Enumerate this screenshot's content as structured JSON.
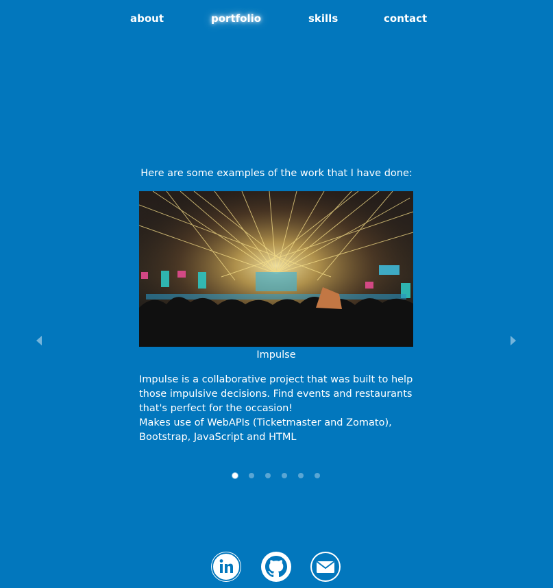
{
  "nav": {
    "items": [
      {
        "label": "about"
      },
      {
        "label": "portfolio",
        "active": true
      },
      {
        "label": "skills"
      },
      {
        "label": "contact"
      }
    ]
  },
  "portfolio": {
    "intro": "Here are some examples of the work that I have done:",
    "slides": [
      {
        "title": "Impulse",
        "image": "concert-lights-image",
        "description_lines": [
          "Impulse is a collaborative project that was built to help those impulsive decisions. Find events and restaurants that's perfect for the occasion!",
          "Makes use of WebAPIs (Ticketmaster and Zomato), Bootstrap, JavaScript and HTML"
        ]
      }
    ],
    "active_slide": 1,
    "slide_count": 6,
    "controls": {
      "prev_icon": "caret-left-icon",
      "next_icon": "caret-right-icon"
    }
  },
  "social": [
    {
      "name": "linkedin",
      "icon": "linkedin-icon"
    },
    {
      "name": "github",
      "icon": "github-icon"
    },
    {
      "name": "email",
      "icon": "envelope-icon"
    }
  ],
  "colors": {
    "background": "#0277bd",
    "text": "#ffffff",
    "icon_bg": "#ffffff",
    "icon_fg": "#0277bd"
  }
}
